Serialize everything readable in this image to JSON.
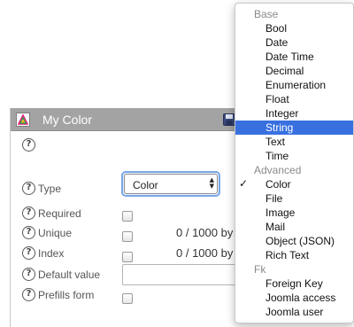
{
  "panel": {
    "title": "My Color",
    "type_label": "Type",
    "type_value": "Color",
    "rows": [
      {
        "label": "Required"
      },
      {
        "label": "Unique",
        "counter": "0 / 1000 by"
      },
      {
        "label": "Index",
        "counter": "0 / 1000 by"
      },
      {
        "label": "Default value"
      },
      {
        "label": "Prefills form"
      }
    ],
    "help_glyph": "?",
    "select_arrows": {
      "up": "▲",
      "down": "▼"
    }
  },
  "menu": {
    "groups": [
      {
        "label": "Base",
        "items": [
          "Bool",
          "Date",
          "Date Time",
          "Decimal",
          "Enumeration",
          "Float",
          "Integer",
          "String",
          "Text",
          "Time"
        ]
      },
      {
        "label": "Advanced",
        "items": [
          "Color",
          "File",
          "Image",
          "Mail",
          "Object (JSON)",
          "Rich Text"
        ]
      },
      {
        "label": "Fk",
        "items": [
          "Foreign Key",
          "Joomla access",
          "Joomla user"
        ]
      }
    ],
    "highlighted": "String",
    "checked": "Color",
    "check_glyph": "✓"
  },
  "colors": {
    "header_bg": "#a3a3a3",
    "highlight": "#3870e0",
    "focus_ring": "#7aa7e6"
  },
  "icons": [
    "color-type-icon",
    "save-icon",
    "help-icon",
    "checkmark-icon"
  ]
}
